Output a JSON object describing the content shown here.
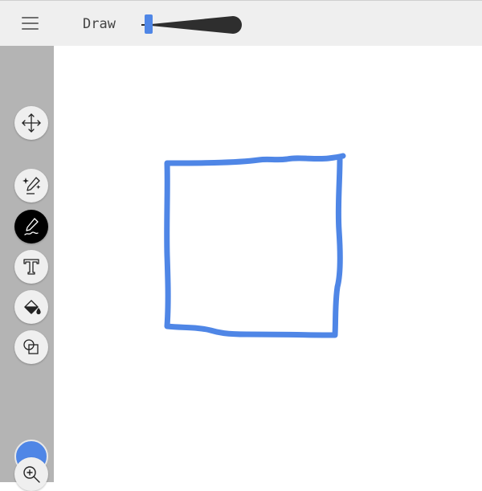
{
  "toolbar": {
    "mode_title": "Draw",
    "pen_size_percent": 0
  },
  "sidebar": {
    "tools": [
      {
        "name": "move",
        "icon": "move-arrows-icon",
        "active": false
      },
      {
        "name": "magic-pen",
        "icon": "magic-pen-icon",
        "active": false
      },
      {
        "name": "pen",
        "icon": "pen-icon",
        "active": true
      },
      {
        "name": "text",
        "icon": "text-icon",
        "active": false
      },
      {
        "name": "fill",
        "icon": "paint-bucket-icon",
        "active": false
      },
      {
        "name": "shapes",
        "icon": "shapes-icon",
        "active": false
      },
      {
        "name": "zoom",
        "icon": "zoom-in-icon",
        "active": false
      }
    ],
    "current_color": "#4f86e6"
  },
  "canvas": {
    "stroke_color": "#4f86e6",
    "background": "#ffffff"
  }
}
